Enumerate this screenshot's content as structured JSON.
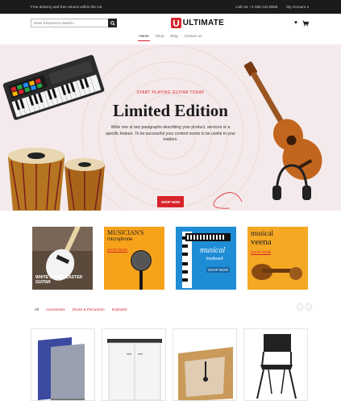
{
  "topbar": {
    "promo": "Free delivery and free returns within the US",
    "call": "Call Us: +1 555 123 9069",
    "account": "My Account"
  },
  "header": {
    "search_placeholder": "Enter Keyword to Search...",
    "logo_text": "ULTIMATE",
    "icons": [
      "heart-icon",
      "cart-icon"
    ]
  },
  "nav": {
    "items": [
      "Home",
      "Shop",
      "Blog",
      "Contact us"
    ],
    "active": "Home"
  },
  "hero": {
    "subtitle": "START PLAYING GUITAR TODAY",
    "title": "Limited Edition",
    "paragraph": "Write one or two paragraphs describing your product, services or a specific feature. To be successful your content needs to be useful to your readers.",
    "button": "SHOP NOW"
  },
  "categories": [
    {
      "line1": "WHITE STRATOCASTER",
      "line2": "GUITAR",
      "cta": "SHOP NOW"
    },
    {
      "line1": "MUSICIAN'S",
      "line2": "microphone",
      "cta": "SHOP NOW"
    },
    {
      "line1": "musical",
      "line2": "keyboard",
      "cta": "SHOP NOW"
    },
    {
      "line1": "musical",
      "line2": "veena",
      "cta": "SHOP NOW"
    }
  ],
  "filter_tabs": [
    "All",
    "Accessories",
    "Drums & Percussion",
    "Keyboard"
  ],
  "colors": {
    "accent": "#d8232a",
    "topbar": "#1b1b1b",
    "hero_bg": "#f5eaeb"
  }
}
